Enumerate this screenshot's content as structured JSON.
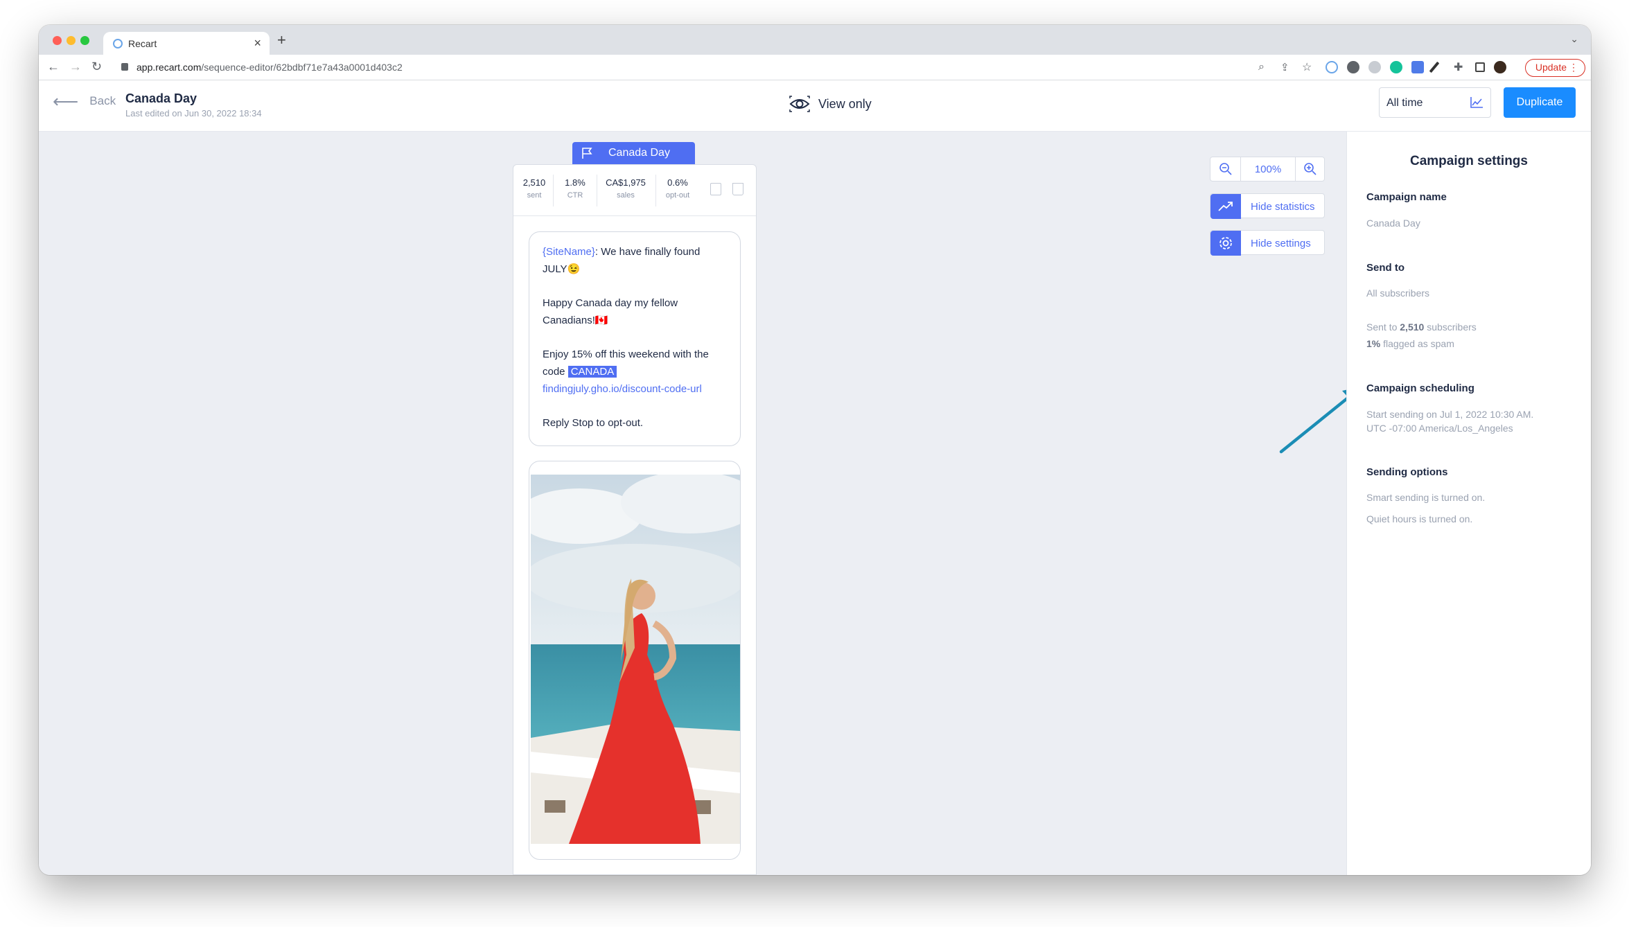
{
  "browser": {
    "tab_title": "Recart",
    "url_host": "app.recart.com",
    "url_path": "/sequence-editor/62bdbf71e7a43a0001d403c2",
    "update_label": "Update"
  },
  "header": {
    "back_label": "Back",
    "title": "Canada Day",
    "subtitle": "Last edited on Jun 30, 2022 18:34",
    "view_mode": "View only",
    "date_range": "All time",
    "duplicate_label": "Duplicate"
  },
  "message": {
    "flag_label": "Canada Day",
    "stats": [
      {
        "value": "2,510",
        "label": "sent"
      },
      {
        "value": "1.8%",
        "label": "CTR"
      },
      {
        "value": "CA$1,975",
        "label": "sales"
      },
      {
        "value": "0.6%",
        "label": "opt-out"
      }
    ],
    "sitename_tag": "{SiteName}",
    "line1_rest": ": We have finally found JULY😉",
    "line2": "Happy Canada day my fellow Canadians!🇨🇦",
    "line3_prefix": "Enjoy 15% off this weekend with the code ",
    "code": "CANADA",
    "link": "findingjuly.gho.io/discount-code-url",
    "optout": "Reply Stop to opt-out."
  },
  "controls": {
    "zoom": "100%",
    "hide_statistics": "Hide statistics",
    "hide_settings": "Hide settings"
  },
  "settings": {
    "title": "Campaign settings",
    "name_label": "Campaign name",
    "name_value": "Canada Day",
    "sendto_label": "Send to",
    "sendto_value": "All subscribers",
    "sent_prefix": "Sent to ",
    "sent_count": "2,510",
    "sent_suffix": " subscribers",
    "spam_pct": "1%",
    "spam_suffix": " flagged as spam",
    "scheduling_label": "Campaign scheduling",
    "scheduling_line1": "Start sending on Jul 1, 2022 10:30 AM.",
    "scheduling_line2": "UTC -07:00 America/Los_Angeles",
    "options_label": "Sending options",
    "option1": "Smart sending is turned on.",
    "option2": "Quiet hours is turned on."
  },
  "colors": {
    "accent": "#4f6ef2",
    "primary_button": "#1a8cff",
    "annotation_arrow": "#1b8db5"
  }
}
